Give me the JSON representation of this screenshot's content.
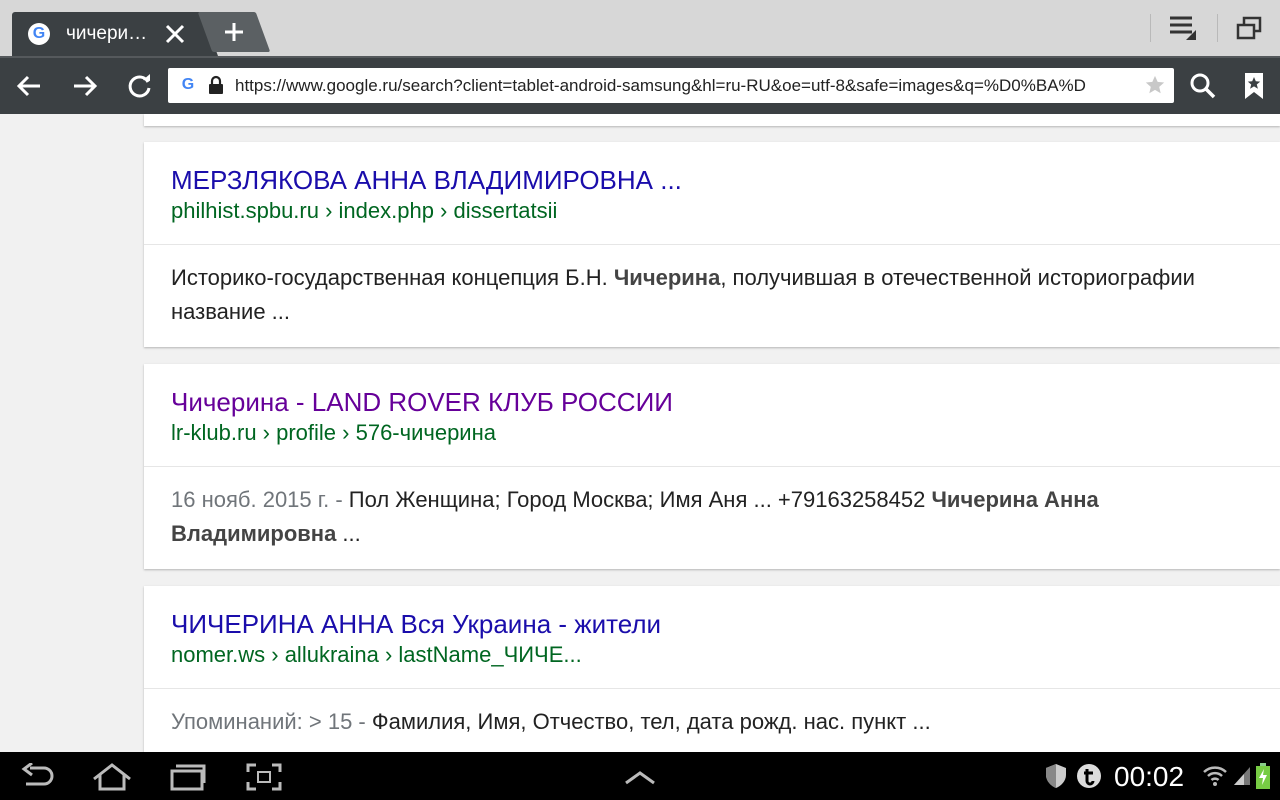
{
  "browser": {
    "tab": {
      "title": "чичери…",
      "favicon": "google-g-icon"
    },
    "url": "https://www.google.ru/search?client=tablet-android-samsung&hl=ru-RU&oe=utf-8&safe=images&q=%D0%BA%D"
  },
  "results": [
    {
      "title": "МЕРЗЛЯКОВА АННА ВЛАДИМИРОВНА ...",
      "url": "philhist.spbu.ru › index.php › dissertatsii",
      "visited": false,
      "snippet_line1_a": "Историко-государственная концепция Б.Н. ",
      "snippet_line1_b": "Чичерина",
      "snippet_line1_c": ", получившая в отечественной историографии",
      "snippet_line2": "название ..."
    },
    {
      "title": "Чичерина - LAND ROVER КЛУБ РОССИИ",
      "url": "lr-klub.ru › profile › 576-чичерина",
      "visited": true,
      "date": "16 нояб. 2015 г. - ",
      "snippet_line1_a": "Пол Женщина; Город Москва; Имя Аня ... +79163258452 ",
      "snippet_line1_b": "Чичерина Анна",
      "snippet_line2_b": "Владимировна",
      "snippet_line2_c": " ..."
    },
    {
      "title": "ЧИЧЕРИНА АННА Вся Украина - жители",
      "url": "nomer.ws › allukraina › lastName_ЧИЧЕ...",
      "visited": false,
      "date": "Упоминаний: > 15 - ",
      "snippet_line1_a": "Фамилия, Имя, Отчество, тел, дата рожд. нас. пункт ..."
    }
  ],
  "statusbar": {
    "time": "00:02",
    "icons": [
      "shield-icon",
      "t-app-icon",
      "wifi-icon",
      "signal-icon",
      "battery-charging-icon"
    ]
  },
  "colors": {
    "link": "#1a0dab",
    "visited": "#660099",
    "url": "#006621",
    "toolbar": "#3b4043"
  }
}
